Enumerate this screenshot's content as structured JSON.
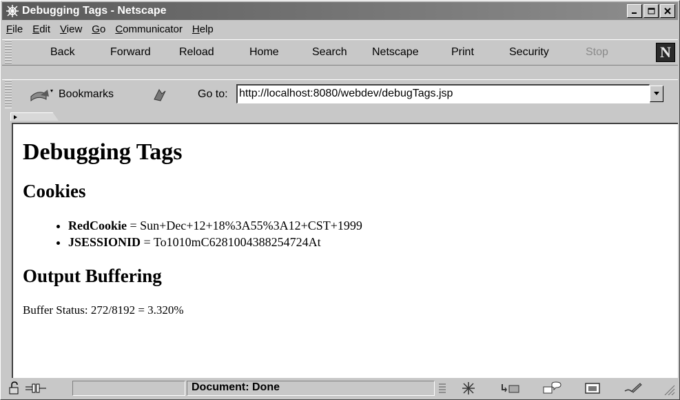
{
  "window": {
    "title": "Debugging Tags - Netscape"
  },
  "menu": [
    "File",
    "Edit",
    "View",
    "Go",
    "Communicator",
    "Help"
  ],
  "menu_mnemonics": [
    "F",
    "E",
    "V",
    "G",
    "C",
    "H"
  ],
  "nav_toolbar": {
    "buttons": [
      "Back",
      "Forward",
      "Reload",
      "Home",
      "Search",
      "Netscape",
      "Print",
      "Security",
      "Stop"
    ],
    "logo": "N"
  },
  "location_toolbar": {
    "bookmarks_label": "Bookmarks",
    "goto_label": "Go to:",
    "url": "http://localhost:8080/webdev/debugTags.jsp"
  },
  "page": {
    "title": "Debugging Tags",
    "cookies_heading": "Cookies",
    "cookies": [
      {
        "name": "RedCookie",
        "separator": " = ",
        "value": "Sun+Dec+12+18%3A55%3A12+CST+1999"
      },
      {
        "name": "JSESSIONID",
        "separator": " = ",
        "value": "To1010mC6281004388254724At"
      }
    ],
    "output_heading": "Output Buffering",
    "buffer_label": "Buffer Status:",
    "buffer_value": "272/8192 = 3.320%"
  },
  "status": {
    "text": "Document: Done"
  },
  "icons": {
    "app": "netscape-globe-icon",
    "security": "lock-icon",
    "connection": "connection-icon"
  }
}
